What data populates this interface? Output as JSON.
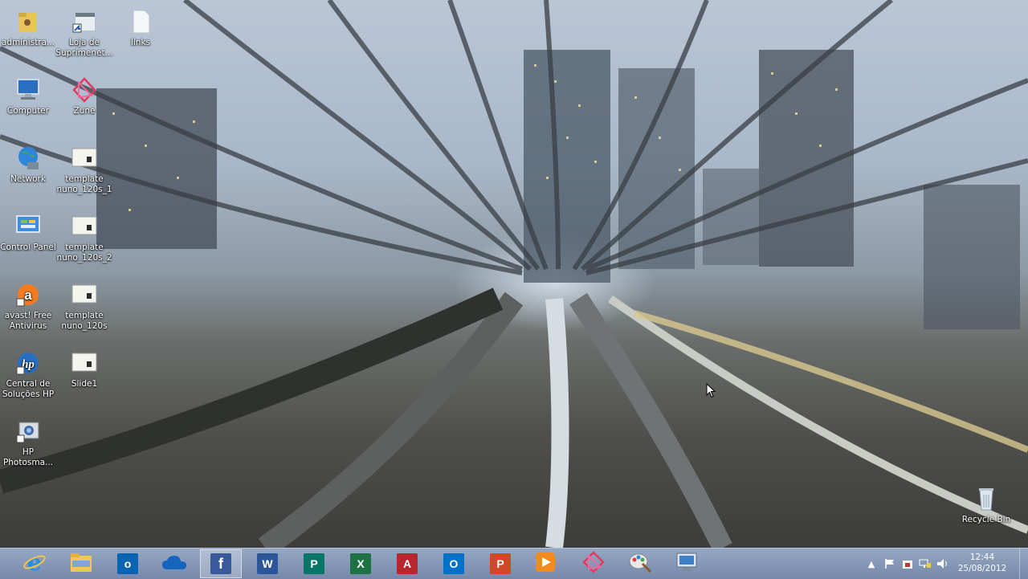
{
  "desktop": {
    "icons": [
      {
        "name": "administra-folder",
        "label": "administra...",
        "icon": "user-folder-icon"
      },
      {
        "name": "loja-de-suprimentos",
        "label": "Loja de Suprimenet...",
        "icon": "store-shortcut-icon"
      },
      {
        "name": "links",
        "label": "links",
        "icon": "blank-file-icon"
      },
      {
        "name": "computer",
        "label": "Computer",
        "icon": "computer-icon"
      },
      {
        "name": "zune",
        "label": "Zune",
        "icon": "zune-icon"
      },
      {
        "name": "network",
        "label": "Network",
        "icon": "network-globe-icon"
      },
      {
        "name": "template-nuno-120s-1",
        "label": "template nuno_120s_1",
        "icon": "slide-file-icon"
      },
      {
        "name": "control-panel",
        "label": "Control Panel",
        "icon": "control-panel-icon"
      },
      {
        "name": "template-nuno-120s-2",
        "label": "template nuno_120s_2",
        "icon": "slide-file-icon"
      },
      {
        "name": "avast-free-antivirus",
        "label": "avast! Free Antivirus",
        "icon": "avast-icon"
      },
      {
        "name": "template-nuno-120s",
        "label": "template nuno_120s",
        "icon": "slide-file-icon"
      },
      {
        "name": "central-de-solucoes-hp",
        "label": "Central de Soluções HP",
        "icon": "hp-icon"
      },
      {
        "name": "slide1",
        "label": "Slide1",
        "icon": "slide-file-icon"
      },
      {
        "name": "hp-photosmart",
        "label": "HP Photosma...",
        "icon": "hp-photosmart-icon"
      },
      {
        "name": "recycle-bin",
        "label": "Recycle Bin",
        "icon": "recycle-bin-icon"
      }
    ]
  },
  "taskbar": {
    "pinned": [
      {
        "name": "internet-explorer",
        "icon": "internet-explorer-icon",
        "glyph": "e",
        "color": "#1e90e6"
      },
      {
        "name": "file-explorer",
        "icon": "folder-icon",
        "glyph": "",
        "color": "#f2c65a"
      },
      {
        "name": "outlook",
        "icon": "outlook-icon",
        "glyph": "o",
        "color": "#0a64b4"
      },
      {
        "name": "skydrive",
        "icon": "cloud-icon",
        "glyph": "",
        "color": "#1565c0"
      },
      {
        "name": "facebook",
        "icon": "facebook-icon",
        "glyph": "f",
        "color": "#3b5998"
      },
      {
        "name": "word",
        "icon": "word-icon",
        "glyph": "W",
        "color": "#2b579a"
      },
      {
        "name": "publisher",
        "icon": "publisher-icon",
        "glyph": "P",
        "color": "#077568"
      },
      {
        "name": "excel",
        "icon": "excel-icon",
        "glyph": "X",
        "color": "#1e7145"
      },
      {
        "name": "access",
        "icon": "access-icon",
        "glyph": "A",
        "color": "#b7282e"
      },
      {
        "name": "outlook-2",
        "icon": "outlook-icon",
        "glyph": "O",
        "color": "#0072c6"
      },
      {
        "name": "powerpoint",
        "icon": "powerpoint-icon",
        "glyph": "P",
        "color": "#d24726"
      },
      {
        "name": "media-player",
        "icon": "play-icon",
        "glyph": "▶",
        "color": "#f58a1f"
      },
      {
        "name": "zune",
        "icon": "zune-icon",
        "glyph": "",
        "color": "#e8447a"
      },
      {
        "name": "paint",
        "icon": "paint-icon",
        "glyph": "",
        "color": "#d9d9d9"
      },
      {
        "name": "remote-desktop",
        "icon": "remote-desktop-icon",
        "glyph": "",
        "color": "#d9e6f2"
      }
    ],
    "tray_icons": [
      "chevron-up-icon",
      "flag-icon",
      "security-icon",
      "network-icon",
      "volume-icon"
    ],
    "clock": {
      "time": "12:44",
      "date": "25/08/2012"
    }
  },
  "colors": {
    "taskbar": "#8ca0be",
    "icon_text": "#ffffff"
  }
}
